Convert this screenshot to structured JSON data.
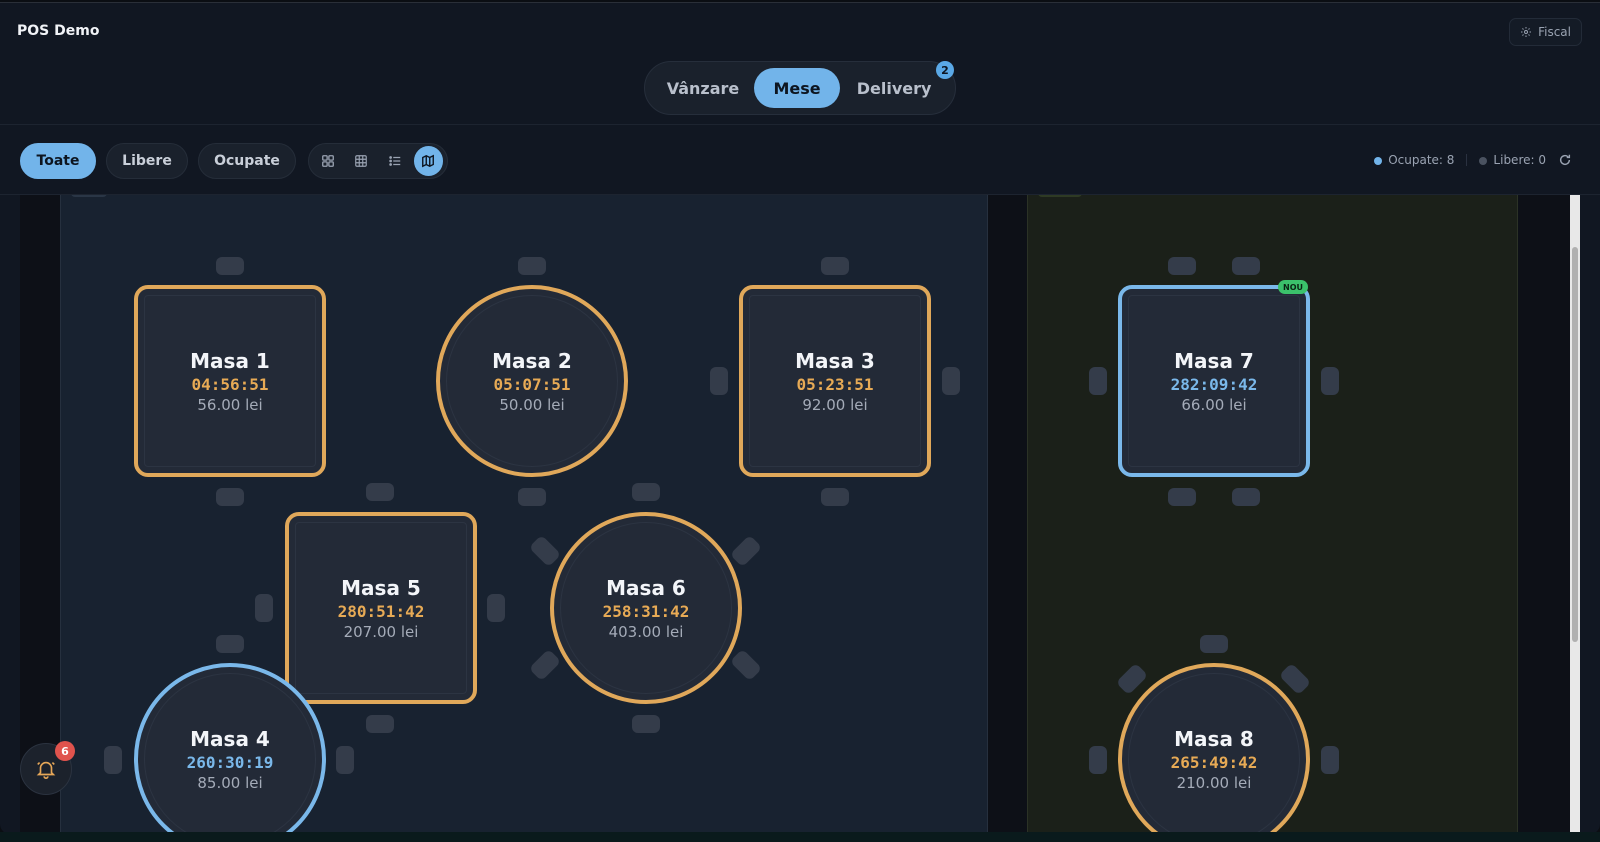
{
  "app": {
    "title": "POS Demo",
    "fiscal_label": "Fiscal"
  },
  "mode_tabs": [
    {
      "label": "Vânzare",
      "active": false
    },
    {
      "label": "Mese",
      "active": true
    },
    {
      "label": "Delivery",
      "active": false,
      "badge": "2"
    }
  ],
  "filters": [
    {
      "label": "Toate",
      "active": true
    },
    {
      "label": "Libere",
      "active": false
    },
    {
      "label": "Ocupate",
      "active": false
    }
  ],
  "view_modes": [
    {
      "icon": "grid-large-icon",
      "active": false
    },
    {
      "icon": "grid-small-icon",
      "active": false
    },
    {
      "icon": "list-icon",
      "active": false
    },
    {
      "icon": "map-icon",
      "active": true
    }
  ],
  "summary": {
    "occupied_label": "Ocupate: 8",
    "free_label": "Libere: 0"
  },
  "colors": {
    "accent": "#72b4ea",
    "busy": "#e0a85a",
    "new": "#7ab8ea",
    "new_badge": "#3bc16b",
    "notification": "#e0534d"
  },
  "tables": [
    {
      "name": "Masa 1",
      "time": "04:56:51",
      "amount": "56.00 lei",
      "shape": "square",
      "status": "busy"
    },
    {
      "name": "Masa 2",
      "time": "05:07:51",
      "amount": "50.00 lei",
      "shape": "round",
      "status": "busy"
    },
    {
      "name": "Masa 3",
      "time": "05:23:51",
      "amount": "92.00 lei",
      "shape": "square",
      "status": "busy"
    },
    {
      "name": "Masa 4",
      "time": "260:30:19",
      "amount": "85.00 lei",
      "shape": "round",
      "status": "new"
    },
    {
      "name": "Masa 5",
      "time": "280:51:42",
      "amount": "207.00 lei",
      "shape": "square",
      "status": "busy"
    },
    {
      "name": "Masa 6",
      "time": "258:31:42",
      "amount": "403.00 lei",
      "shape": "round",
      "status": "busy"
    },
    {
      "name": "Masa 7",
      "time": "282:09:42",
      "amount": "66.00 lei",
      "shape": "square",
      "status": "new",
      "badge": "NOU"
    },
    {
      "name": "Masa 8",
      "time": "265:49:42",
      "amount": "210.00 lei",
      "shape": "round",
      "status": "busy"
    }
  ],
  "notifications": {
    "count": "6"
  }
}
